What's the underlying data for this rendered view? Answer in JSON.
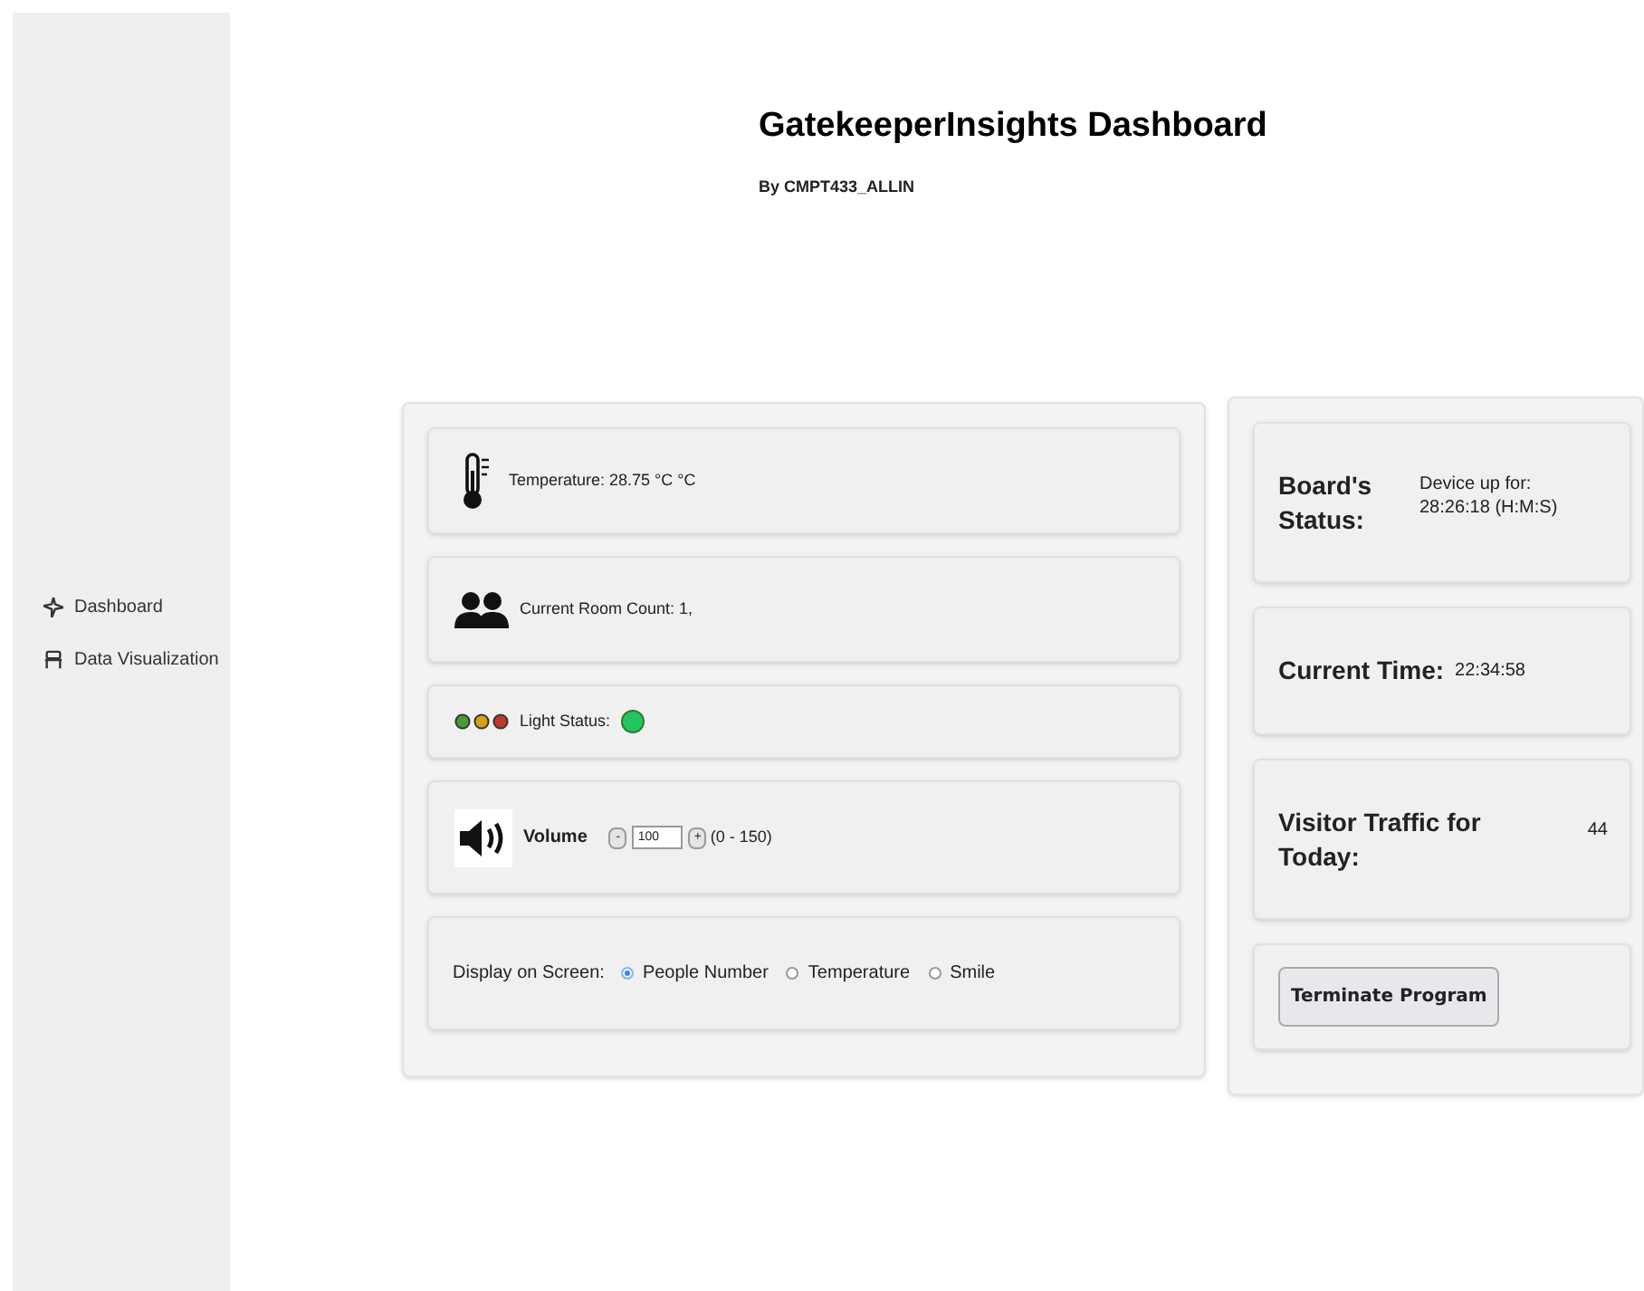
{
  "sidebar": {
    "items": [
      {
        "label": "Dashboard",
        "kind": "dashboard"
      },
      {
        "label": "Data Visualization",
        "kind": "visualization"
      }
    ]
  },
  "header": {
    "title": "GatekeeperInsights Dashboard",
    "subtitle": "By CMPT433_ALLIN"
  },
  "sensors": [
    {
      "kind": "temperature",
      "text": "Temperature: 28.75 °C °C"
    },
    {
      "kind": "room_count",
      "text": "Current Room Count: 1,"
    },
    {
      "kind": "light",
      "text": "Light Status:",
      "color": "#22c55e"
    },
    {
      "kind": "volume",
      "label": "Volume",
      "minus": "-",
      "value": "100",
      "plus": "+",
      "range": "(0 - 150)"
    },
    {
      "kind": "display",
      "label": "Display on Screen:",
      "options": [
        {
          "label": "People Number",
          "selected": true
        },
        {
          "label": "Temperature",
          "selected": false
        },
        {
          "label": "Smile",
          "selected": false
        }
      ]
    }
  ],
  "status": [
    {
      "kind": "board",
      "label": "Board's Status:",
      "value": "Device up for: 28:26:18 (H:M:S)"
    },
    {
      "kind": "time",
      "label": "Current Time:",
      "value": "22:34:58"
    },
    {
      "kind": "traffic",
      "label": "Visitor Traffic for Today:",
      "value": "44"
    },
    {
      "kind": "button",
      "label": "Terminate Program"
    }
  ]
}
